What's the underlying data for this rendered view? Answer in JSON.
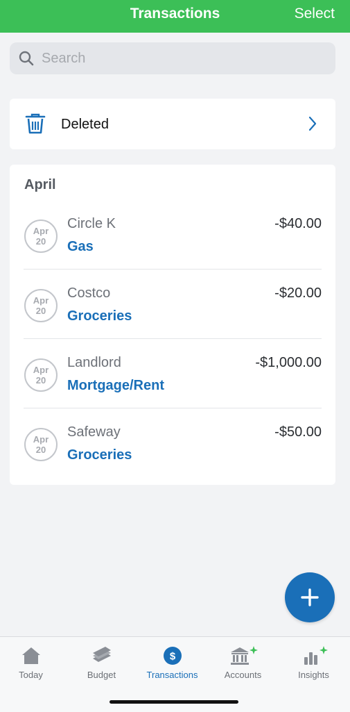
{
  "header": {
    "title": "Transactions",
    "select_label": "Select"
  },
  "search": {
    "placeholder": "Search",
    "value": ""
  },
  "deleted": {
    "label": "Deleted"
  },
  "month": {
    "title": "April",
    "transactions": [
      {
        "date_month": "Apr",
        "date_day": "20",
        "payee": "Circle K",
        "category": "Gas",
        "amount": "-$40.00"
      },
      {
        "date_month": "Apr",
        "date_day": "20",
        "payee": "Costco",
        "category": "Groceries",
        "amount": "-$20.00"
      },
      {
        "date_month": "Apr",
        "date_day": "20",
        "payee": "Landlord",
        "category": "Mortgage/Rent",
        "amount": "-$1,000.00"
      },
      {
        "date_month": "Apr",
        "date_day": "20",
        "payee": "Safeway",
        "category": "Groceries",
        "amount": "-$50.00"
      }
    ]
  },
  "tabs": [
    {
      "label": "Today",
      "icon": "house-icon"
    },
    {
      "label": "Budget",
      "icon": "budget-icon"
    },
    {
      "label": "Transactions",
      "icon": "dollar-icon",
      "active": true
    },
    {
      "label": "Accounts",
      "icon": "bank-icon",
      "badge": "sparkle"
    },
    {
      "label": "Insights",
      "icon": "bar-chart-icon",
      "badge": "sparkle"
    }
  ],
  "colors": {
    "header": "#3cbf57",
    "accent": "#1a6fb8",
    "sparkle": "#3cbf57"
  }
}
